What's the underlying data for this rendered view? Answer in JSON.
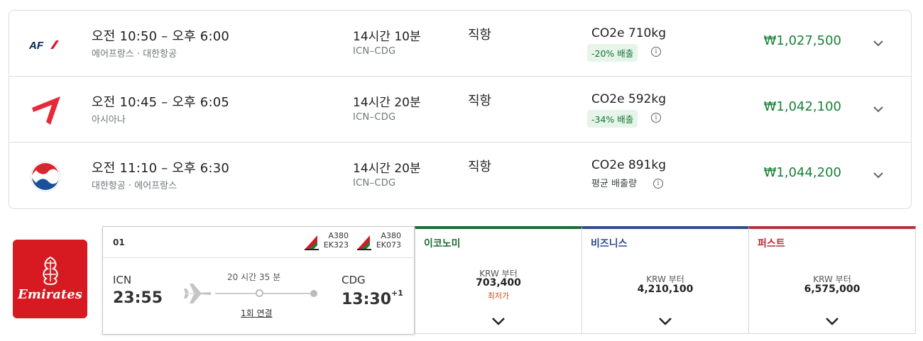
{
  "flights": [
    {
      "times": "오전 10:50 – 오후 6:00",
      "airline": "에어프랑스 · 대한항공",
      "duration": "14시간 10분",
      "route": "ICN–CDG",
      "stops": "직항",
      "co2": "CO2e 710kg",
      "co2_note": "-20% 배출",
      "price": "₩1,027,500",
      "logo": "air-france-logo"
    },
    {
      "times": "오전 10:45 – 오후 6:05",
      "airline": "아시아나",
      "duration": "14시간 20분",
      "route": "ICN–CDG",
      "stops": "직항",
      "co2": "CO2e 592kg",
      "co2_note": "-34% 배출",
      "price": "₩1,042,100",
      "logo": "asiana-logo"
    },
    {
      "times": "오전 11:10 – 오후 6:30",
      "airline": "대한항공 · 에어프랑스",
      "duration": "14시간 20분",
      "route": "ICN–CDG",
      "stops": "직항",
      "co2": "CO2e 891kg",
      "co2_note": "평균 배출량",
      "price": "₩1,044,200",
      "logo": "korean-air-logo"
    }
  ],
  "af_logo_text": "AF",
  "emirates": {
    "logo_text": "Emirates",
    "flight_number": "01",
    "aircraft": [
      {
        "type": "A380",
        "code": "EK323"
      },
      {
        "type": "A380",
        "code": "EK073"
      }
    ],
    "origin": "ICN",
    "depart": "23:55",
    "destination": "CDG",
    "arrive": "13:30",
    "day_offset": "+1",
    "duration": "20 시간 35 분",
    "connections": "1회 연결",
    "cabins": [
      {
        "name": "이코노미",
        "from": "KRW 부터",
        "amount": "703,400",
        "badge": "최저가",
        "color": "#1e6b34"
      },
      {
        "name": "비즈니스",
        "from": "KRW 부터",
        "amount": "4,210,100",
        "badge": "",
        "color": "#2f4d8e"
      },
      {
        "name": "퍼스트",
        "from": "KRW 부터",
        "amount": "6,575,000",
        "badge": "",
        "color": "#b5303a"
      }
    ]
  },
  "colors": {
    "price_green": "#188038",
    "co2_badge_bg": "#e6f4ea",
    "emirates_red": "#d71921"
  }
}
